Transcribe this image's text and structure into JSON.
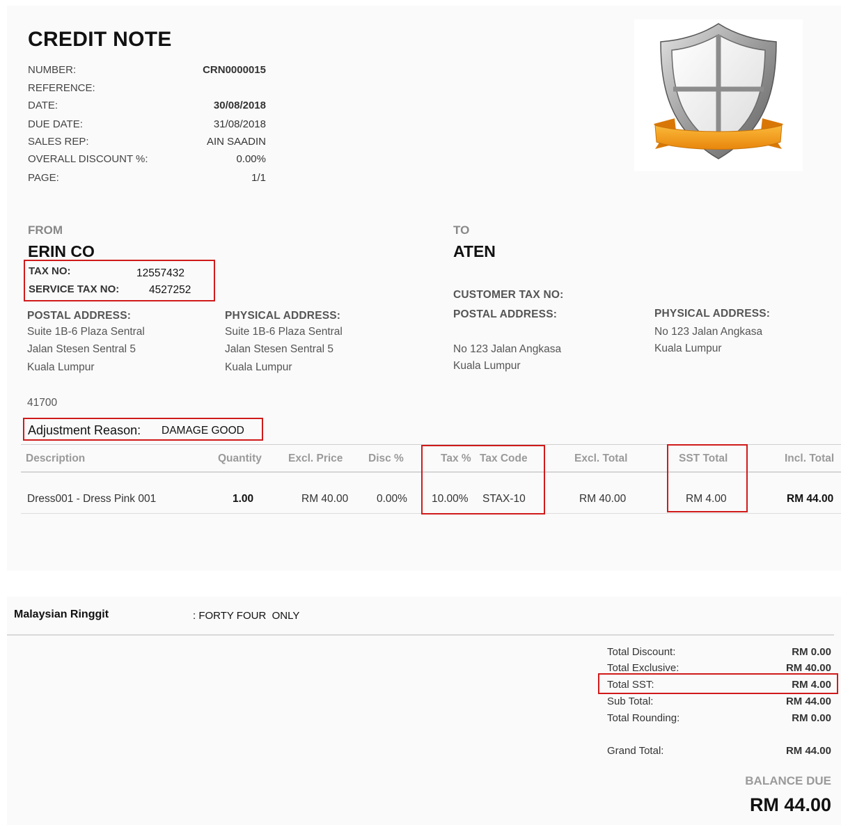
{
  "document": {
    "title": "CREDIT NOTE",
    "meta": [
      {
        "label": "NUMBER:",
        "value": "CRN0000015"
      },
      {
        "label": "REFERENCE:",
        "value": ""
      },
      {
        "label": "DATE:",
        "value": "30/08/2018"
      },
      {
        "label": "DUE DATE:",
        "value": "31/08/2018"
      },
      {
        "label": "SALES REP:",
        "value": "AIN SAADIN"
      },
      {
        "label": "OVERALL DISCOUNT %:",
        "value": "0.00%"
      },
      {
        "label": "PAGE:",
        "value": "1/1"
      }
    ]
  },
  "logo": {
    "icon": "shield-icon",
    "shield_color": "#9e9e9e",
    "ribbon_color": "#f7a21b"
  },
  "from": {
    "heading": "FROM",
    "name": "ERIN CO",
    "tax_no_label": "TAX NO:",
    "tax_no": "12557432",
    "service_tax_label": "SERVICE TAX NO:",
    "service_tax_no": "4527252",
    "postal_heading": "POSTAL ADDRESS:",
    "postal": [
      "Suite 1B-6 Plaza Sentral",
      "Jalan Stesen Sentral 5",
      "Kuala Lumpur"
    ],
    "physical_heading": "PHYSICAL ADDRESS:",
    "physical": [
      "Suite 1B-6 Plaza Sentral",
      "Jalan Stesen Sentral 5",
      "Kuala Lumpur"
    ],
    "postcode": "41700"
  },
  "to": {
    "heading": "TO",
    "name": "ATEN",
    "customer_tax_label": "CUSTOMER TAX NO:",
    "postal_heading": "POSTAL ADDRESS:",
    "postal": [
      "No 123 Jalan Angkasa",
      "Kuala Lumpur"
    ],
    "physical_heading": "PHYSICAL ADDRESS:",
    "physical": [
      "No 123 Jalan Angkasa",
      "Kuala Lumpur"
    ]
  },
  "adjustment": {
    "label": "Adjustment Reason:",
    "value": "DAMAGE GOOD"
  },
  "table": {
    "headers": {
      "description": "Description",
      "quantity": "Quantity",
      "excl_price": "Excl. Price",
      "disc": "Disc %",
      "tax_pct": "Tax %",
      "tax_code": "Tax Code",
      "excl_total": "Excl. Total",
      "sst_total": "SST Total",
      "incl_total": "Incl. Total"
    },
    "rows": [
      {
        "description": "Dress001 - Dress Pink 001",
        "quantity": "1.00",
        "excl_price": "RM 40.00",
        "disc": "0.00%",
        "tax_pct": "10.00%",
        "tax_code": "STAX-10",
        "excl_total": "RM 40.00",
        "sst_total": "RM 4.00",
        "incl_total": "RM 44.00"
      }
    ]
  },
  "amount_words": {
    "currency": "Malaysian Ringgit",
    "text": ": FORTY FOUR  ONLY"
  },
  "totals": [
    {
      "label": "Total Discount:",
      "value": "RM 0.00"
    },
    {
      "label": "Total Exclusive:",
      "value": "RM 40.00"
    },
    {
      "label": "Total SST:",
      "value": "RM 4.00"
    },
    {
      "label": "Sub Total:",
      "value": "RM 44.00"
    },
    {
      "label": "Total Rounding:",
      "value": "RM 0.00"
    },
    {
      "label": "Grand Total:",
      "value": "RM 44.00"
    }
  ],
  "balance": {
    "label": "BALANCE DUE",
    "value": "RM 44.00"
  },
  "colors": {
    "highlight_box": "#d01a1a",
    "panel_bg": "#fafafa"
  }
}
